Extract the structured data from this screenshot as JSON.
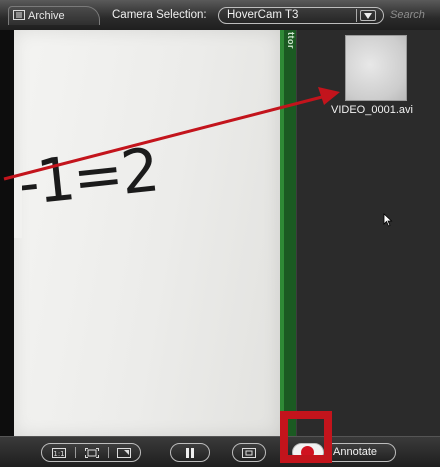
{
  "toolbar": {
    "archive_label": "Archive",
    "camera_selection_label": "Camera Selection:",
    "camera_value": "HoverCam T3",
    "search_label": "Search"
  },
  "camera_view": {
    "handwriting_text": "-1=2",
    "strip_text": "ttor"
  },
  "media_panel": {
    "items": [
      {
        "filename": "VIDEO_0001.avi"
      }
    ]
  },
  "bottom_toolbar": {
    "zoom_buttons": [
      "1:1 view",
      "fit view",
      "crop view"
    ],
    "annotate_label": "Annotate"
  },
  "annotations": {
    "arrow_color": "#c3141c",
    "highlight_color": "#c3141c"
  },
  "colors": {
    "record_dot": "#d01220",
    "board_green": "#1c6e24",
    "panel_bg": "#2b2b2b"
  }
}
